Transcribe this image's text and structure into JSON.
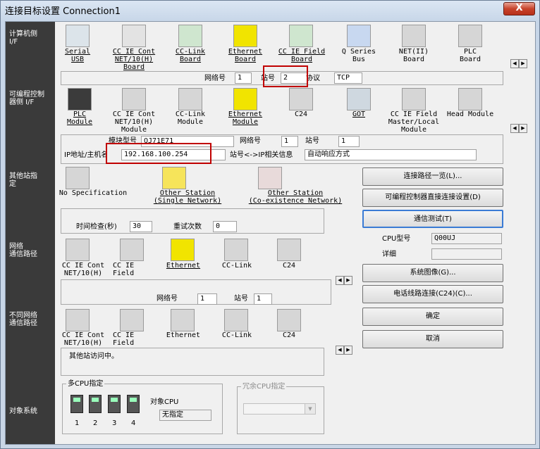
{
  "window": {
    "title": "连接目标设置 Connection1",
    "close": "X"
  },
  "left_labels": {
    "pc_if": "计算机侧\nI/F",
    "plc_if": "可编程控制\n器侧 I/F",
    "other_station": "其他站指\n定",
    "network_route": "网络\n通信路径",
    "diff_network": "不同网络\n通信路径",
    "target_system": "对象系统"
  },
  "pc_side": {
    "items": [
      {
        "label": "Serial\nUSB"
      },
      {
        "label": "CC IE Cont\nNET/10(H)\nBoard"
      },
      {
        "label": "CC-Link\nBoard"
      },
      {
        "label": "Ethernet\nBoard"
      },
      {
        "label": "CC IE Field\nBoard"
      },
      {
        "label": "Q Series\nBus"
      },
      {
        "label": "NET(II)\nBoard"
      },
      {
        "label": "PLC\nBoard"
      }
    ],
    "network_no_label": "网络号",
    "network_no": "1",
    "station_no_label": "站号",
    "station_no": "2",
    "protocol_label": "协议",
    "protocol": "TCP"
  },
  "plc_side": {
    "items": [
      {
        "label": "PLC\nModule"
      },
      {
        "label": "CC IE Cont\nNET/10(H)\nModule"
      },
      {
        "label": "CC-Link\nModule"
      },
      {
        "label": "Ethernet\nModule"
      },
      {
        "label": "C24"
      },
      {
        "label": "GOT"
      },
      {
        "label": "CC IE Field\nMaster/Local\nModule"
      },
      {
        "label": "Head Module"
      }
    ],
    "module_type_label": "模块型号",
    "module_type": "QJ71E71",
    "network_no_label": "网络号",
    "network_no": "1",
    "station_no_label": "站号",
    "station_no": "1",
    "ip_label": "IP地址/主机名",
    "ip": "192.168.100.254",
    "station_ip_label": "站号<->IP相关信息",
    "station_ip": "自动响应方式"
  },
  "other_station": {
    "items": [
      {
        "label": "No Specification"
      },
      {
        "label": "Other Station\n(Single Network)"
      },
      {
        "label": "Other Station\n(Co-existence Network)"
      }
    ],
    "timeout_label": "时间检查(秒)",
    "timeout": "30",
    "retry_label": "重试次数",
    "retry": "0"
  },
  "network_route": {
    "items": [
      {
        "label": "CC IE Cont\nNET/10(H)"
      },
      {
        "label": "CC IE\nField"
      },
      {
        "label": "Ethernet"
      },
      {
        "label": "CC-Link"
      },
      {
        "label": "C24"
      }
    ],
    "network_no_label": "网络号",
    "network_no": "1",
    "station_no_label": "站号",
    "station_no": "1"
  },
  "diff_network": {
    "items": [
      {
        "label": "CC IE Cont\nNET/10(H)"
      },
      {
        "label": "CC IE\nField"
      },
      {
        "label": "Ethernet"
      },
      {
        "label": "CC-Link"
      },
      {
        "label": "C24"
      }
    ],
    "message": "其他站访问中。"
  },
  "target_system": {
    "multi_cpu_label": "多CPU指定",
    "target_cpu_label": "对象CPU",
    "target_cpu": "无指定",
    "cpu_numbers": [
      "1",
      "2",
      "3",
      "4"
    ],
    "redundant_label": "冗余CPU指定"
  },
  "right_panel": {
    "route_list": "连接路径一览(L)...",
    "direct_plc": "可编程控制器直接连接设置(D)",
    "comm_test": "通信测试(T)",
    "cpu_type_label": "CPU型号",
    "cpu_type": "Q00UJ",
    "detail_label": "详细",
    "detail": "",
    "system_image": "系统图像(G)...",
    "phone_line": "电话线路连接(C24)(C)...",
    "ok": "确定",
    "cancel": "取消"
  }
}
